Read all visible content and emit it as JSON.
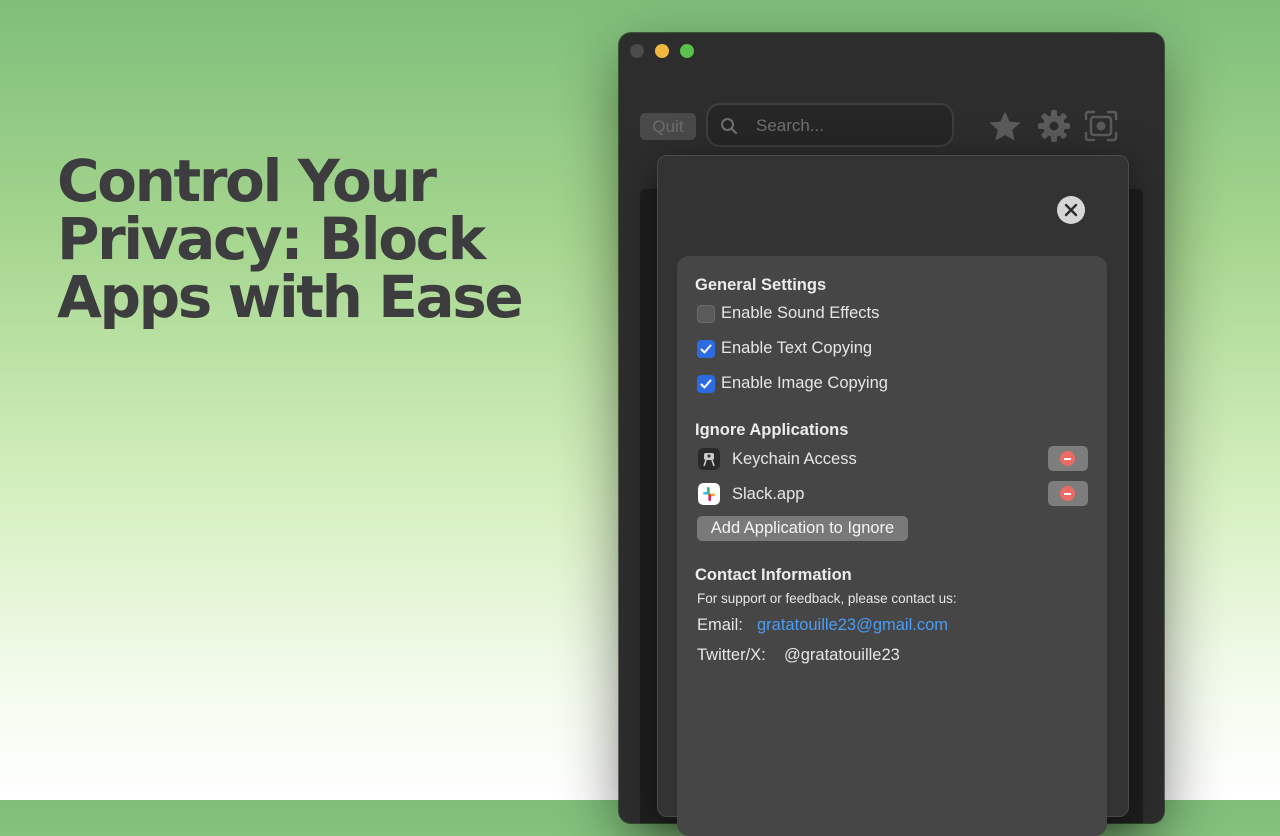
{
  "headline": {
    "line1": "Control Your",
    "line2": "Privacy: Block",
    "line3": "Apps with Ease"
  },
  "toolbar": {
    "quit_label": "Quit",
    "search_placeholder": "Search..."
  },
  "general": {
    "title": "General Settings",
    "options": [
      {
        "label": "Enable Sound Effects",
        "checked": false
      },
      {
        "label": "Enable Text Copying",
        "checked": true
      },
      {
        "label": "Enable Image Copying",
        "checked": true
      }
    ]
  },
  "ignore": {
    "title": "Ignore Applications",
    "apps": [
      {
        "name": "Keychain Access",
        "icon": "keychain-icon"
      },
      {
        "name": "Slack.app",
        "icon": "slack-icon"
      }
    ],
    "add_label": "Add Application to Ignore"
  },
  "contact": {
    "title": "Contact Information",
    "subtitle": "For support or feedback, please contact us:",
    "email_label": "Email:",
    "email": "gratatouille23@gmail.com",
    "twitter_label": "Twitter/X:",
    "twitter": "@gratatouille23"
  },
  "colors": {
    "accent_checkbox": "#2d6be0",
    "link": "#4a9cf5",
    "remove": "#f06a64"
  }
}
